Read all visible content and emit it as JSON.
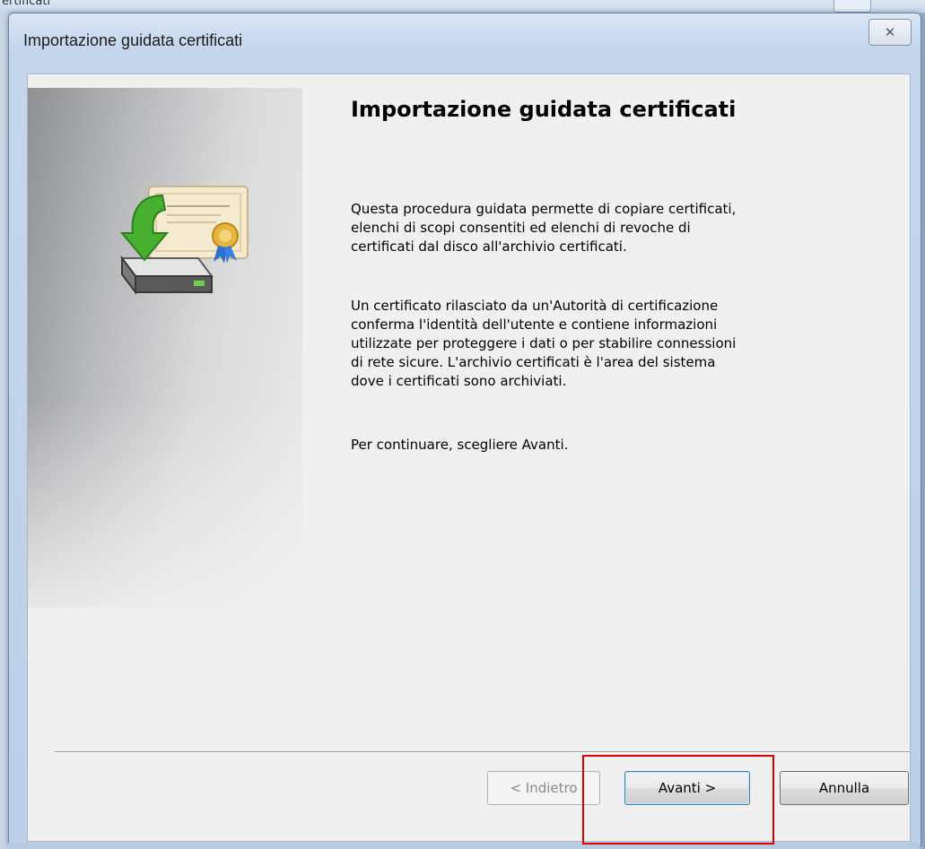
{
  "background_window": {
    "title_fragment": "ertificati"
  },
  "dialog": {
    "title": "Importazione guidata certificati",
    "close_glyph": "✕"
  },
  "wizard": {
    "icon": "certificate-import-icon",
    "heading": "Importazione guidata certificati",
    "paragraph1": "Questa procedura guidata permette di copiare certificati,\nelenchi di scopi consentiti ed elenchi di revoche di\ncertificati dal disco all'archivio certificati.",
    "paragraph2": "Un certificato rilasciato da un'Autorità di certificazione\nconferma l'identità dell'utente e contiene informazioni\nutilizzate per proteggere i dati o per stabilire connessioni\ndi rete sicure. L'archivio certificati è l'area del sistema\ndove i certificati sono archiviati.",
    "paragraph3": "Per continuare, scegliere Avanti."
  },
  "buttons": {
    "back_label": "< Indietro",
    "next_label": "Avanti >",
    "cancel_label": "Annulla"
  },
  "colors": {
    "highlight": "#e00000",
    "default_button_border": "#3c7fb1"
  }
}
